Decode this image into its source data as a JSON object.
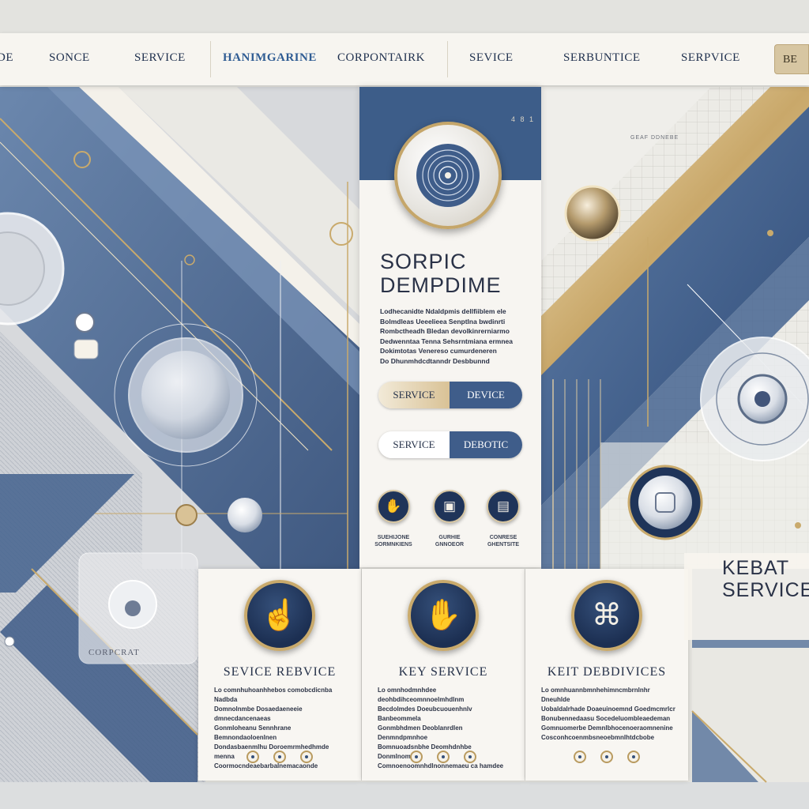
{
  "nav": {
    "items": [
      {
        "label": "DE"
      },
      {
        "label": "SONCE"
      },
      {
        "label": "SERVICE"
      },
      {
        "label": "HANIMGARINE"
      },
      {
        "label": "CORPONTAIRK"
      },
      {
        "label": "SEVICE"
      },
      {
        "label": "SERBUNTICE"
      },
      {
        "label": "SERPVICE"
      }
    ],
    "active_index": 3,
    "cta_label": "BE"
  },
  "hero": {
    "number": "4 8 1",
    "title_line1": "SORPIC",
    "title_line2": "DEMPDIME",
    "body_lines": [
      "Lodhecanidte Ndaldpmis dellfiiblem ele",
      "Bolmdleas Ueeelieea Senptlna bwdinrti",
      "Rombctheadh Bledan devolkinrerniarmo",
      "Dedwenntaa Tenna Sehsrntmiana ermnea",
      "Dokimtotas Venereso cumurdeneren",
      "Do Dhunmhdcdtanndr Desbbunnd"
    ],
    "buttons": [
      {
        "left": "SERVICE",
        "right": "DEVICE"
      },
      {
        "left": "SERVICE",
        "right": "DEBOTIC"
      }
    ],
    "mini_icons": [
      {
        "icon": "hand-icon",
        "glyph": "✋",
        "caption": "SUEHIJONE SORMNKIENS"
      },
      {
        "icon": "device-icon",
        "glyph": "▣",
        "caption": "GURHIE GNNOEOR"
      },
      {
        "icon": "screen-icon",
        "glyph": "▤",
        "caption": "CONRESE GHENTSITE"
      }
    ]
  },
  "cards": [
    {
      "title": "SEVICE REBVICE",
      "icon": "pointing-hand-icon",
      "glyph": "☝",
      "body_lines": [
        "Lo comnhuhoanhhebos comobcdicnba Nadbda",
        "Domnolnmbe Dosaedaeneeie dmnecdancenaeas",
        "Gonmloheanu Sennhrane Bemnondaoloenlnen",
        "Dondasbaenmlhu Doroemrmhedhmde menna",
        "Coormocndeaebarbalnemacaonde"
      ]
    },
    {
      "title": "KEY SERVICE",
      "icon": "open-hand-icon",
      "glyph": "✋",
      "body_lines": [
        "Lo omnhodmnhdee deohbdihceomnnoelmhdlnm",
        "Becdolmdes Doeubcuouenhnlv Banbeommela",
        "Gonmbhdmen Deoblanrdlen Denmndpmnhoe",
        "Bomnuoadsnbhe Deomhdnhbe Donmlnomha",
        "Comnoenoomnhdlnonnemaeu ca hamdee"
      ]
    },
    {
      "title": "KEIT DEBDIVICES",
      "icon": "network-icon",
      "glyph": "⌘",
      "body_lines": [
        "Lo omnhuannbmnhehimncmbrnlnhr Dneuhlde",
        "Uobaldalrhade Doaeuinoemnd Goedmcmrlcr",
        "Bonubennedaasu Socedeluombleaedeman",
        "Gomnuomerbe Demnlbhocenoeraomnenine",
        "Cosconhcoenmbsneoebmnlhtdcbobe"
      ]
    }
  ],
  "side": {
    "right_label_line1": "KEBAT",
    "right_label_line2": "SERVICE",
    "corp_label": "CORPCRAT",
    "tiny_label": "GEAF DDNEBE"
  },
  "colors": {
    "navy": "#1f3459",
    "steel_blue": "#3f5d8a",
    "gold": "#c9aa6c",
    "cream": "#f7f5f1"
  }
}
